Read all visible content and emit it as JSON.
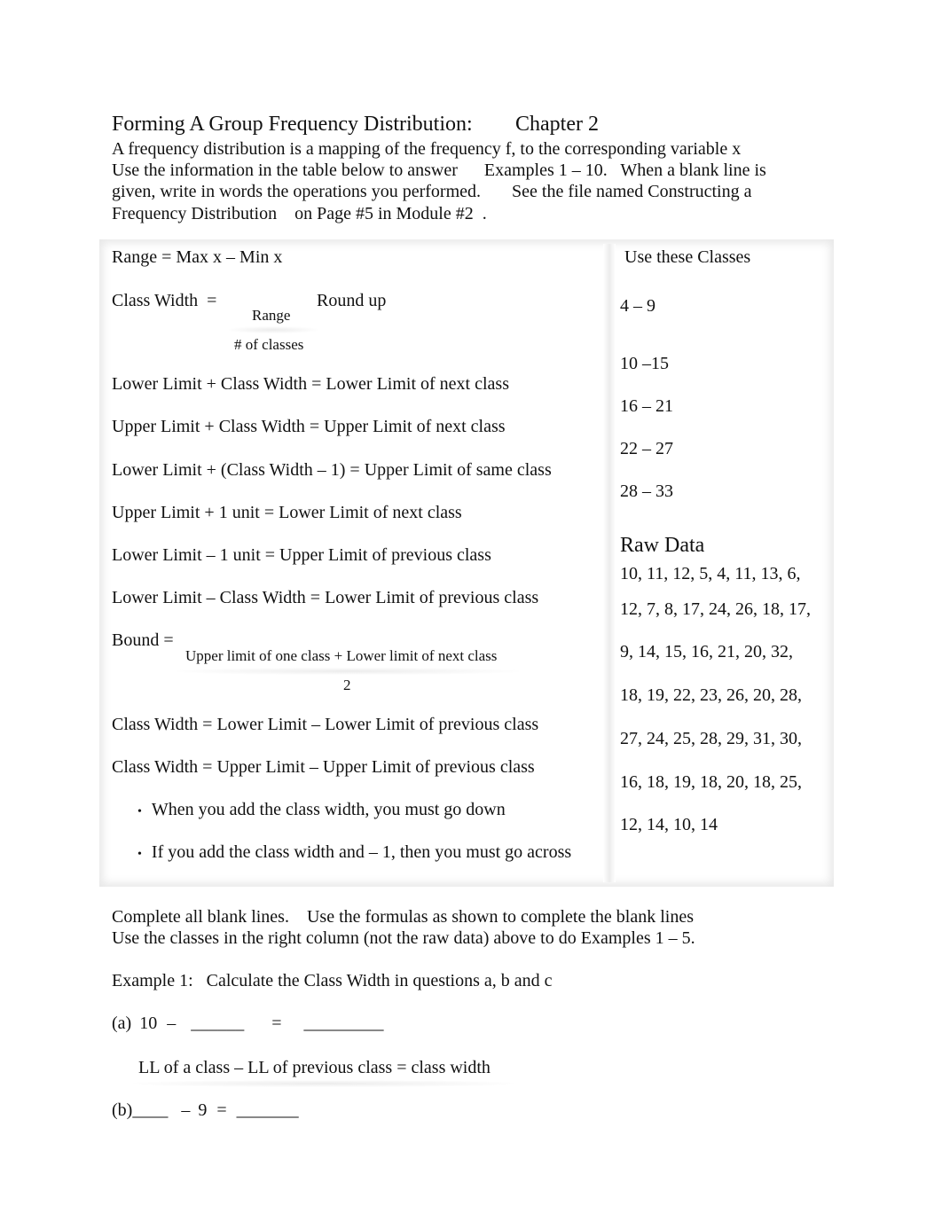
{
  "header": {
    "title": "Forming A Group Frequency Distribution:",
    "chapter": "Chapter 2",
    "intro_lines": [
      "A frequency distribution is a mapping of the frequency f, to the corresponding variable x",
      "Use the information in the table below to answer      Examples 1 – 10.   When a blank line is",
      "given, write in words the operations you performed.       See the file named Constructing a",
      "Frequency Distribution    on Page #5 in Module #2  ."
    ]
  },
  "formulas": {
    "range": "Range = Max x – Min x",
    "class_width_label": "Class Width  =",
    "class_width_numerator": "Range",
    "class_width_denominator": "# of classes",
    "class_width_note": "Round up",
    "rules": [
      "Lower Limit + Class Width = Lower Limit of next class",
      "Upper Limit + Class Width = Upper Limit of next class",
      "Lower Limit + (Class Width – 1) = Upper Limit of same class",
      "Upper Limit + 1 unit = Lower Limit of next class",
      "Lower Limit – 1 unit = Upper Limit of previous class",
      "Lower Limit – Class Width = Lower Limit of previous class"
    ],
    "bound_label": "Bound =",
    "bound_numerator": "Upper limit of one class + Lower limit of next class",
    "bound_denominator": "2",
    "width_rules": [
      "Class Width = Lower Limit – Lower Limit of previous class",
      "Class Width = Upper Limit – Upper Limit of previous class"
    ],
    "bullets": [
      "When you add the class width, you must go down",
      "If you add the class width and – 1, then you must go across"
    ]
  },
  "classes": {
    "heading": "Use these Classes",
    "items": [
      "4 – 9",
      "10 –15",
      "16 – 21",
      "22 – 27",
      "28 – 33"
    ]
  },
  "raw_data": {
    "heading": "Raw Data",
    "lines": [
      "10, 11, 12, 5, 4, 11, 13, 6,",
      "12, 7, 8, 17, 24, 26, 18, 17,",
      "9, 14, 15, 16, 21, 20, 32,",
      "18, 19, 22, 23, 26, 20, 28,",
      "27, 24, 25, 28, 29, 31, 30,",
      "16, 18, 19, 18, 20, 18, 25,",
      "12, 14, 10, 14"
    ]
  },
  "instructions": [
    "Complete all blank lines.    Use the formulas as shown to complete the blank lines",
    "Use the classes in the right column (not the raw data) above to do Examples 1 – 5."
  ],
  "example1": {
    "title": "Example 1:   Calculate the Class Width in questions a, b and c",
    "a": {
      "label": "(a)",
      "minuend": "10",
      "minus": "–",
      "blank1": "______",
      "equals": "=",
      "blank2": "_________"
    },
    "hint": "LL of a class – LL of previous class = class width",
    "b": {
      "label": "(b)",
      "blank1": "____",
      "minus": "–",
      "subtrahend": "9",
      "equals": "=",
      "blank2": "_______"
    }
  }
}
